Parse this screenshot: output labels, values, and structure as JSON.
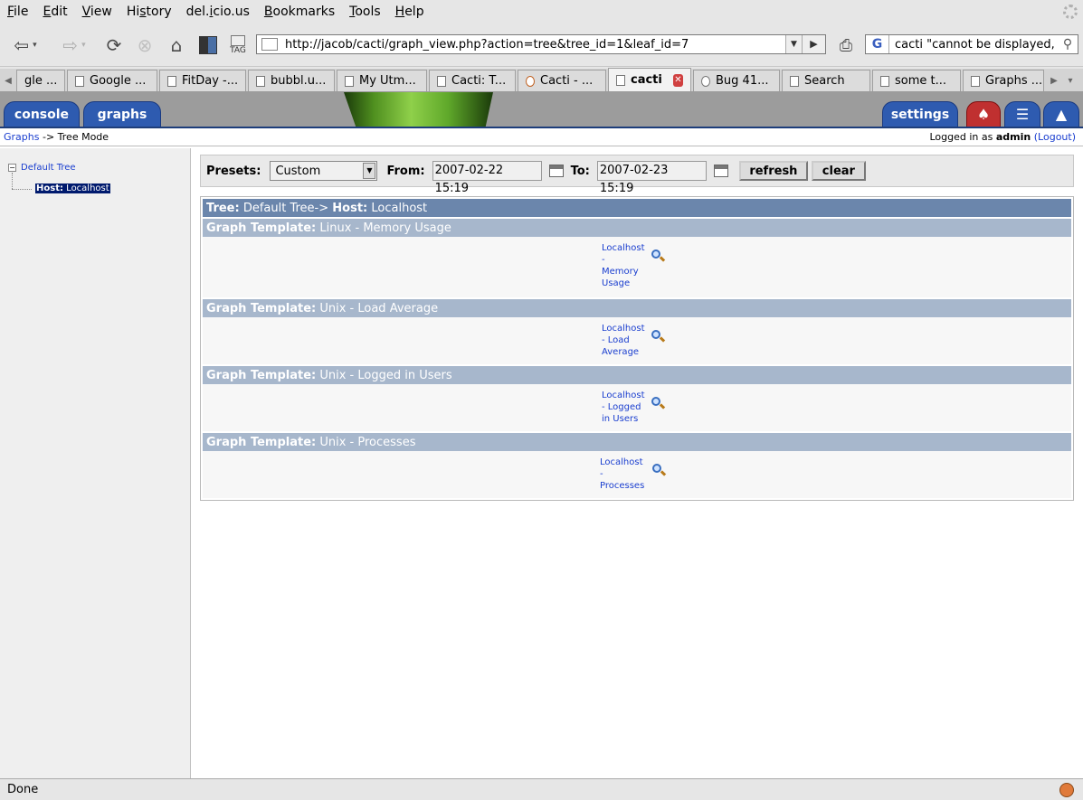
{
  "menu": [
    "File",
    "Edit",
    "View",
    "History",
    "del.icio.us",
    "Bookmarks",
    "Tools",
    "Help"
  ],
  "menu_accel": [
    "F",
    "E",
    "V",
    "s",
    "i",
    "B",
    "T",
    "H"
  ],
  "nav": {
    "url": "http://jacob/cacti/graph_view.php?action=tree&tree_id=1&leaf_id=7",
    "search": "cacti \"cannot be displayed,",
    "tag_label": "TAG",
    "search_engine": "G"
  },
  "tabs": [
    {
      "label": "gle ..."
    },
    {
      "label": "Google ..."
    },
    {
      "label": "FitDay -..."
    },
    {
      "label": "bubbl.u..."
    },
    {
      "label": "My Utm..."
    },
    {
      "label": "Cacti: T..."
    },
    {
      "label": "Cacti - ..."
    },
    {
      "label": "cacti",
      "active": true
    },
    {
      "label": "Bug 41..."
    },
    {
      "label": "Search"
    },
    {
      "label": "some t..."
    },
    {
      "label": "Graphs ..."
    }
  ],
  "cacti": {
    "tabs": {
      "console": "console",
      "graphs": "graphs",
      "settings": "settings"
    },
    "breadcrumb": {
      "graphs": "Graphs",
      "arrow": "->",
      "mode": "Tree Mode"
    },
    "login": {
      "prefix": "Logged in as",
      "user": "admin",
      "logout": "(Logout)"
    },
    "tree": {
      "root": "Default Tree",
      "leaf_label": "Host:",
      "leaf_value": "Localhost"
    },
    "presets": {
      "label": "Presets:",
      "value": "Custom",
      "from_label": "From:",
      "from": "2007-02-22 15:19",
      "to_label": "To:",
      "to": "2007-02-23 15:19",
      "refresh": "refresh",
      "clear": "clear"
    },
    "tree_header": {
      "tree_label": "Tree:",
      "tree_value": "Default Tree->",
      "host_label": "Host:",
      "host_value": "Localhost"
    },
    "templates": [
      {
        "label": "Graph Template:",
        "name": "Linux - Memory Usage",
        "lines": [
          "Localhost",
          "-",
          "Memory",
          "Usage"
        ]
      },
      {
        "label": "Graph Template:",
        "name": "Unix - Load Average",
        "lines": [
          "Localhost",
          "- Load",
          "Average"
        ]
      },
      {
        "label": "Graph Template:",
        "name": "Unix - Logged in Users",
        "lines": [
          "Localhost",
          "- Logged",
          "in Users"
        ]
      },
      {
        "label": "Graph Template:",
        "name": "Unix - Processes",
        "lines": [
          "Localhost",
          "-",
          "Processes"
        ]
      }
    ]
  },
  "status": "Done",
  "colors": {
    "cacti_tab": "#2e5bb0",
    "tree_header": "#6b86ac",
    "template_header": "#a7b7cc",
    "link": "#1a3ecf"
  }
}
